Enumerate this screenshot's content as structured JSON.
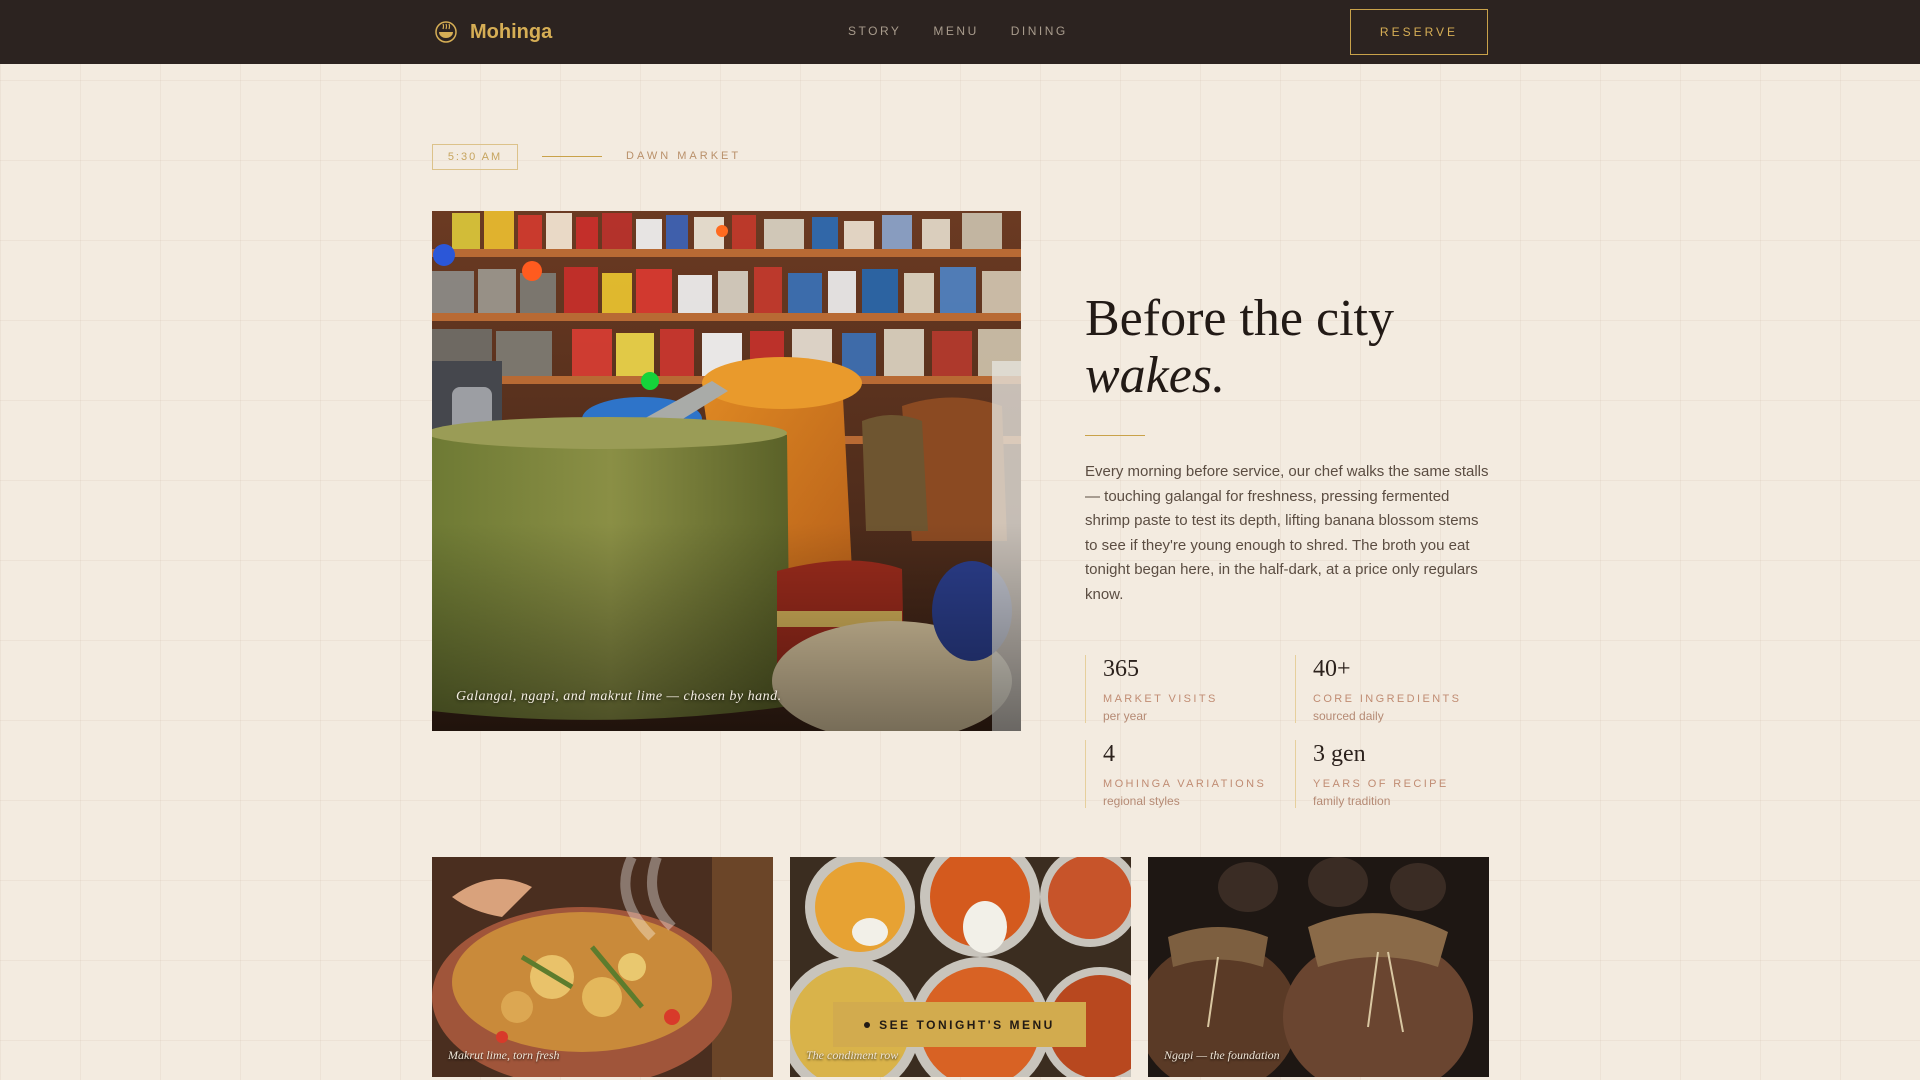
{
  "nav": {
    "brand": "Mohinga",
    "brand_icon": "bowl-icon",
    "links": [
      "STORY",
      "MENU",
      "DINING"
    ],
    "reserve": "RESERVE"
  },
  "section": {
    "time": "5:30 AM",
    "label": "DAWN MARKET"
  },
  "hero": {
    "image_caption": "Galangal, ngapi, and makrut lime — chosen by hand.",
    "headline_line1": "Before the city",
    "headline_line2": "wakes.",
    "body": "Every morning before service, our chef walks the same stalls — touching galangal for freshness, pressing fermented shrimp paste to test its depth, lifting banana blossom stems to see if they're young enough to shred. The broth you eat tonight began here, in the half-dark, at a price only regulars know."
  },
  "stats": [
    {
      "value": "365",
      "label": "MARKET VISITS",
      "sub": "per year"
    },
    {
      "value": "40+",
      "label": "CORE INGREDIENTS",
      "sub": "sourced daily"
    },
    {
      "value": "4",
      "label": "MOHINGA VARIATIONS",
      "sub": "regional styles"
    },
    {
      "value": "3 gen",
      "label": "YEARS OF RECIPE",
      "sub": "family tradition"
    }
  ],
  "cards": [
    {
      "caption": "Makrut lime, torn fresh"
    },
    {
      "caption": "The condiment row"
    },
    {
      "caption": "Ngapi — the foundation"
    }
  ],
  "cta": "SEE TONIGHT'S MENU",
  "colors": {
    "nav_bg": "#2c2320",
    "accent_gold": "#d2ab4e",
    "page_bg": "#f3ebe0",
    "label_rose": "#c08c73"
  }
}
